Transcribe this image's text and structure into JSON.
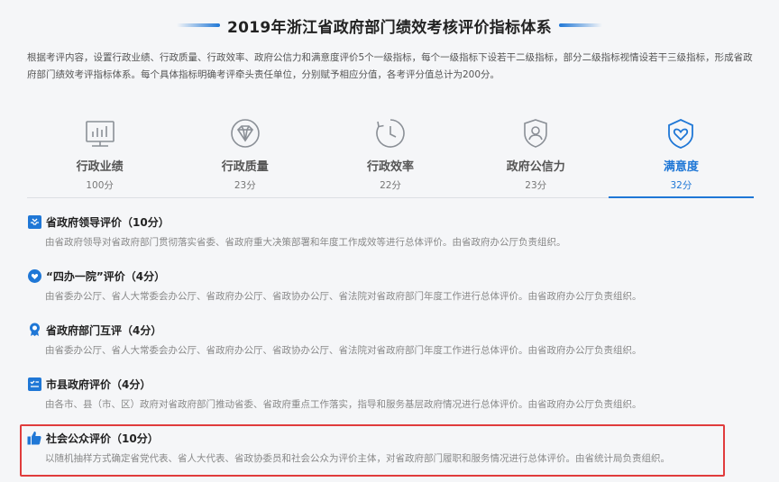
{
  "header": {
    "title": "2019年浙江省政府部门绩效考核评价指标体系"
  },
  "intro": "根据考评内容，设置行政业绩、行政质量、行政效率、政府公信力和满意度评价5个一级指标，每个一级指标下设若干二级指标，部分二级指标视情设若干三级指标，形成省政府部门绩效考评指标体系。每个具体指标明确考评牵头责任单位，分别赋予相应分值，各考评分值总计为200分。",
  "tabs": [
    {
      "name": "行政业绩",
      "score": "100分",
      "icon": "bar-chart-icon"
    },
    {
      "name": "行政质量",
      "score": "23分",
      "icon": "diamond-icon"
    },
    {
      "name": "行政效率",
      "score": "22分",
      "icon": "clock-icon"
    },
    {
      "name": "政府公信力",
      "score": "23分",
      "icon": "shield-user-icon"
    },
    {
      "name": "满意度",
      "score": "32分",
      "icon": "heart-shield-icon"
    }
  ],
  "active_tab": "满意度",
  "colors": {
    "accent": "#1f77d6",
    "highlight": "#e03c3c"
  },
  "items": [
    {
      "title": "省政府领导评价（10分）",
      "desc": "由省政府领导对省政府部门贯彻落实省委、省政府重大决策部署和年度工作成效等进行总体评价。由省政府办公厅负责组织。",
      "icon": "inbox-icon"
    },
    {
      "title": "“四办一院”评价（4分）",
      "desc": "由省委办公厅、省人大常委会办公厅、省政府办公厅、省政协办公厅、省法院对省政府部门年度工作进行总体评价。由省政府办公厅负责组织。",
      "icon": "heart-icon"
    },
    {
      "title": "省政府部门互评（4分）",
      "desc": "由省委办公厅、省人大常委会办公厅、省政府办公厅、省政协办公厅、省法院对省政府部门年度工作进行总体评价。由省政府办公厅负责组织。",
      "icon": "award-icon"
    },
    {
      "title": "市县政府评价（4分）",
      "desc": "由各市、县（市、区）政府对省政府部门推动省委、省政府重点工作落实，指导和服务基层政府情况进行总体评价。由省政府办公厅负责组织。",
      "icon": "checklist-icon"
    },
    {
      "title": "社会公众评价（10分）",
      "desc": "以随机抽样方式确定省党代表、省人大代表、省政协委员和社会公众为评价主体，对省政府部门履职和服务情况进行总体评价。由省统计局负责组织。",
      "icon": "thumbs-up-icon"
    }
  ]
}
